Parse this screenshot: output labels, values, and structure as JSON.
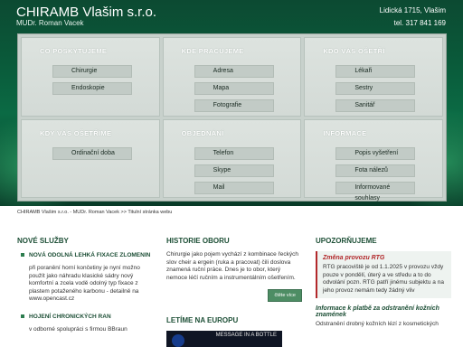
{
  "header": {
    "brand": "CHIRAMB Vlašim s.r.o.",
    "subtitle": "MUDr. Roman Vacek",
    "address": "Lidická 1715, Vlašim",
    "phone": "tel. 317 841 169"
  },
  "menu": [
    {
      "title": "CO POSKYTUJEME",
      "items": [
        "Chirurgie",
        "Endoskopie"
      ]
    },
    {
      "title": "KDE PRACUJEME",
      "items": [
        "Adresa",
        "Mapa",
        "Fotografie"
      ]
    },
    {
      "title": "KDO VÁS OŠETŘÍ",
      "items": [
        "Lékaři",
        "Sestry",
        "Sanitář"
      ]
    },
    {
      "title": "KDY VÁS OŠETŘÍME",
      "items": [
        "Ordinační doba"
      ]
    },
    {
      "title": "OBJEDNÁNÍ",
      "items": [
        "Telefon",
        "Skype",
        "Mail"
      ]
    },
    {
      "title": "INFORMACE",
      "items": [
        "Popis vyšetření",
        "Fota nálezů",
        "Informované souhlasy"
      ]
    }
  ],
  "breadcrumb": "CHIRAMB Vlašim s.r.o. - MUDr. Roman Vacek  >>  Titulní stránka webu",
  "news": {
    "title": "NOVÉ SLUŽBY",
    "item1_title": "NOVÁ ODOLNÁ LEHKÁ FIXACE ZLOMENIN",
    "item1_text": "při poranění horní končetiny je nyní možno použít jako náhradu klasické sádry nový komfortní a zcela vodě odolný typ fixace z plastem potaženého karbonu - detailně na www.opencast.cz",
    "item2_title": "HOJENÍ CHRONICKÝCH RAN",
    "item2_text": "v odborné spolupráci s firmou BBraun"
  },
  "history": {
    "title": "HISTORIE OBORU",
    "text": "Chirurgie jako pojem vychází z kombinace řeckých slov cheir a ergein (ruka a pracovat) čili doslova znamená ruční práce. Dnes je to obor, který nemoce léčí ručním a instrumentálním ošetřením.",
    "more": "čtěte více",
    "europe_title": "LETÍME NA EUROPU",
    "banner_text": "MESSAGE IN A BOTTLE"
  },
  "notice": {
    "title": "UPOZORŇUJEME",
    "change_title": "Změna provozu RTG",
    "change_text": "RTG pracoviště je od 1.1.2025 v provozu vždy pouze v pondělí, úterý a ve středu a to do odvolání pozn. RTG patří jinému subjektu a na jeho provoz nemám tedy žádný vliv",
    "info_title": "Informace k platbě za odstranění kožních znamének",
    "info_text": "Odstranění drobný kožních lézí z kosmetických"
  }
}
